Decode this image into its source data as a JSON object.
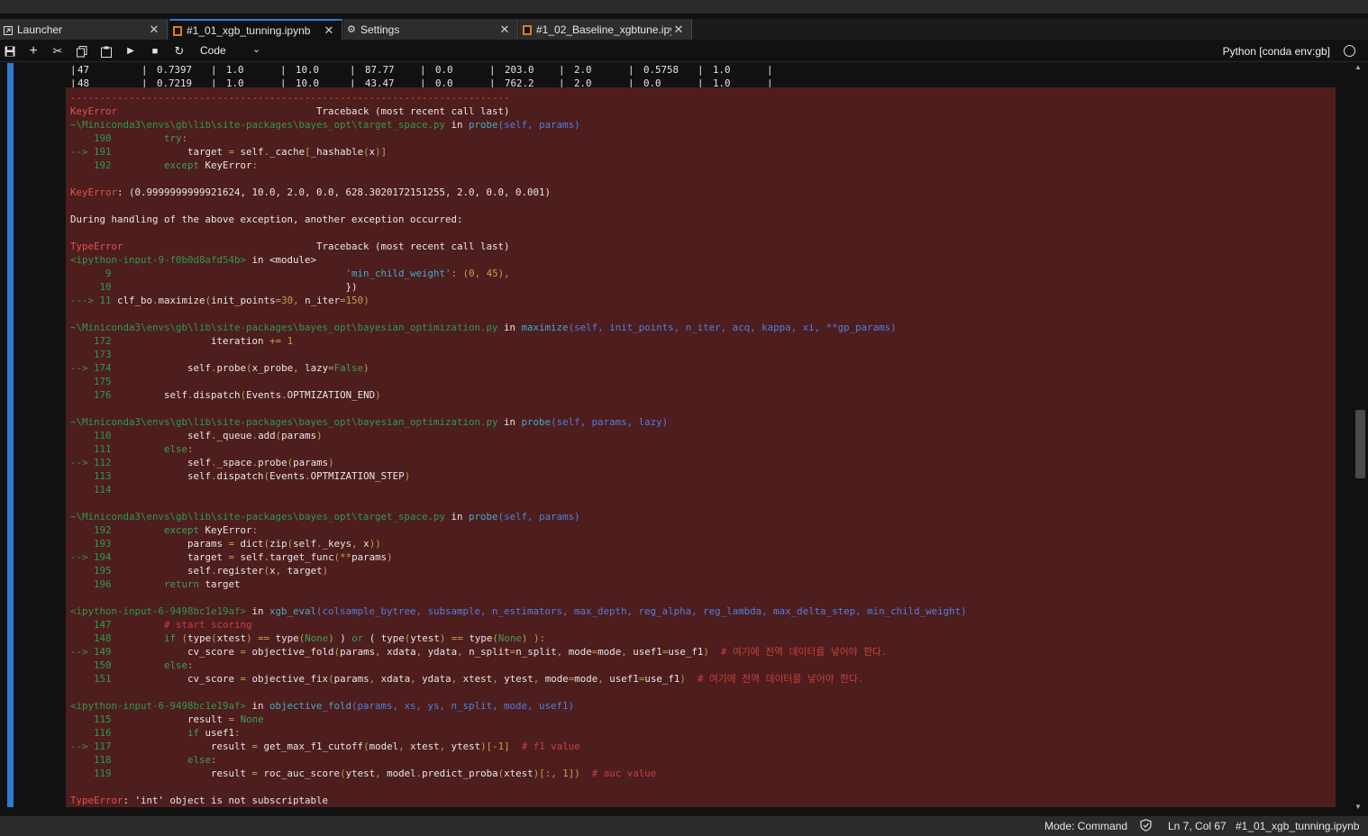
{
  "tabs": [
    {
      "label": "Launcher",
      "icon": "launcher-icon",
      "active": false
    },
    {
      "label": "#1_01_xgb_tunning.ipynb",
      "icon": "notebook-icon",
      "active": true
    },
    {
      "label": "Settings",
      "icon": "gear-icon",
      "active": false
    },
    {
      "label": "#1_02_Baseline_xgbtune.ipynb",
      "icon": "notebook-icon",
      "active": false
    }
  ],
  "toolbar": {
    "cell_type": "Code",
    "kernel": "Python [conda env:gb]",
    "buttons": [
      "save-icon",
      "plus-icon",
      "cut-icon",
      "copy-icon",
      "paste-icon",
      "run-icon",
      "stop-icon",
      "restart-icon"
    ]
  },
  "table_rows": [
    [
      "47",
      "0.7397",
      "1.0",
      "10.0",
      "87.77",
      "0.0",
      "203.0",
      "2.0",
      "0.5758",
      "1.0"
    ],
    [
      "48",
      "0.7219",
      "1.0",
      "10.0",
      "43.47",
      "0.0",
      "762.2",
      "2.0",
      "0.0",
      "1.0"
    ]
  ],
  "traceback": [
    [
      {
        "t": "---------------------------------------------------------------------------",
        "c": "r"
      }
    ],
    [
      {
        "t": "KeyError",
        "c": "r"
      },
      {
        "t": "                                  Traceback (most recent call last)"
      }
    ],
    [
      {
        "t": "~\\Miniconda3\\envs\\gb\\lib\\site-packages\\bayes_opt\\target_space.py",
        "c": "g"
      },
      {
        "t": " in "
      },
      {
        "t": "probe",
        "c": "c"
      },
      {
        "t": "(self, params)",
        "c": "b"
      }
    ],
    [
      {
        "t": "    190",
        "c": "g"
      },
      {
        "t": "         "
      },
      {
        "t": "try",
        "c": "k"
      },
      {
        "t": ":",
        "c": "y"
      }
    ],
    [
      {
        "t": "--> 191",
        "c": "g"
      },
      {
        "t": "             target "
      },
      {
        "t": "=",
        "c": "y"
      },
      {
        "t": " self"
      },
      {
        "t": ".",
        "c": "y"
      },
      {
        "t": "_cache"
      },
      {
        "t": "[",
        "c": "y"
      },
      {
        "t": "_hashable"
      },
      {
        "t": "(",
        "c": "y"
      },
      {
        "t": "x"
      },
      {
        "t": ")]",
        "c": "y"
      }
    ],
    [
      {
        "t": "    192",
        "c": "g"
      },
      {
        "t": "         "
      },
      {
        "t": "except",
        "c": "k"
      },
      {
        "t": " KeyError"
      },
      {
        "t": ":",
        "c": "y"
      }
    ],
    [
      {
        "t": ""
      }
    ],
    [
      {
        "t": "KeyError",
        "c": "r"
      },
      {
        "t": ": (0.9999999999921624, 10.0, 2.0, 0.0, 628.3020172151255, 2.0, 0.0, 0.001)"
      }
    ],
    [
      {
        "t": ""
      }
    ],
    [
      {
        "t": "During handling of the above exception, another exception occurred:"
      }
    ],
    [
      {
        "t": ""
      }
    ],
    [
      {
        "t": "TypeError",
        "c": "r"
      },
      {
        "t": "                                 Traceback (most recent call last)"
      }
    ],
    [
      {
        "t": "<ipython-input-9-f0b0d8afd54b>",
        "c": "g"
      },
      {
        "t": " in "
      },
      {
        "t": "<module>"
      }
    ],
    [
      {
        "t": "      9",
        "c": "g"
      },
      {
        "t": "                                        "
      },
      {
        "t": "'min_child_weight'",
        "c": "c"
      },
      {
        "t": ": ",
        "c": "y"
      },
      {
        "t": "(",
        "c": "y"
      },
      {
        "t": "0",
        "c": "y"
      },
      {
        "t": ", ",
        "c": "y"
      },
      {
        "t": "45",
        "c": "y"
      },
      {
        "t": "),",
        "c": "y"
      }
    ],
    [
      {
        "t": "     10",
        "c": "g"
      },
      {
        "t": "                                        })"
      }
    ],
    [
      {
        "t": "---> 11",
        "c": "g"
      },
      {
        "t": " clf_bo"
      },
      {
        "t": ".",
        "c": "y"
      },
      {
        "t": "maximize"
      },
      {
        "t": "(",
        "c": "y"
      },
      {
        "t": "init_points"
      },
      {
        "t": "=",
        "c": "y"
      },
      {
        "t": "30",
        "c": "y"
      },
      {
        "t": ", ",
        "c": "y"
      },
      {
        "t": "n_iter"
      },
      {
        "t": "=",
        "c": "y"
      },
      {
        "t": "150",
        "c": "y"
      },
      {
        "t": ")",
        "c": "y"
      }
    ],
    [
      {
        "t": ""
      }
    ],
    [
      {
        "t": "~\\Miniconda3\\envs\\gb\\lib\\site-packages\\bayes_opt\\bayesian_optimization.py",
        "c": "g"
      },
      {
        "t": " in "
      },
      {
        "t": "maximize",
        "c": "c"
      },
      {
        "t": "(self, init_points, n_iter, acq, kappa, xi, **gp_params)",
        "c": "b"
      }
    ],
    [
      {
        "t": "    172",
        "c": "g"
      },
      {
        "t": "                 iteration "
      },
      {
        "t": "+=",
        "c": "y"
      },
      {
        "t": " "
      },
      {
        "t": "1",
        "c": "y"
      }
    ],
    [
      {
        "t": "    173",
        "c": "g"
      }
    ],
    [
      {
        "t": "--> 174",
        "c": "g"
      },
      {
        "t": "             self"
      },
      {
        "t": ".",
        "c": "y"
      },
      {
        "t": "probe"
      },
      {
        "t": "(",
        "c": "y"
      },
      {
        "t": "x_probe"
      },
      {
        "t": ", ",
        "c": "y"
      },
      {
        "t": "lazy"
      },
      {
        "t": "=",
        "c": "y"
      },
      {
        "t": "False",
        "c": "k"
      },
      {
        "t": ")",
        "c": "y"
      }
    ],
    [
      {
        "t": "    175",
        "c": "g"
      }
    ],
    [
      {
        "t": "    176",
        "c": "g"
      },
      {
        "t": "         self"
      },
      {
        "t": ".",
        "c": "y"
      },
      {
        "t": "dispatch"
      },
      {
        "t": "(",
        "c": "y"
      },
      {
        "t": "Events"
      },
      {
        "t": ".",
        "c": "y"
      },
      {
        "t": "OPTMIZATION_END"
      },
      {
        "t": ")",
        "c": "y"
      }
    ],
    [
      {
        "t": ""
      }
    ],
    [
      {
        "t": "~\\Miniconda3\\envs\\gb\\lib\\site-packages\\bayes_opt\\bayesian_optimization.py",
        "c": "g"
      },
      {
        "t": " in "
      },
      {
        "t": "probe",
        "c": "c"
      },
      {
        "t": "(self, params, lazy)",
        "c": "b"
      }
    ],
    [
      {
        "t": "    110",
        "c": "g"
      },
      {
        "t": "             self"
      },
      {
        "t": ".",
        "c": "y"
      },
      {
        "t": "_queue"
      },
      {
        "t": ".",
        "c": "y"
      },
      {
        "t": "add"
      },
      {
        "t": "(",
        "c": "y"
      },
      {
        "t": "params"
      },
      {
        "t": ")",
        "c": "y"
      }
    ],
    [
      {
        "t": "    111",
        "c": "g"
      },
      {
        "t": "         "
      },
      {
        "t": "else",
        "c": "k"
      },
      {
        "t": ":",
        "c": "y"
      }
    ],
    [
      {
        "t": "--> 112",
        "c": "g"
      },
      {
        "t": "             self"
      },
      {
        "t": ".",
        "c": "y"
      },
      {
        "t": "_space"
      },
      {
        "t": ".",
        "c": "y"
      },
      {
        "t": "probe"
      },
      {
        "t": "(",
        "c": "y"
      },
      {
        "t": "params"
      },
      {
        "t": ")",
        "c": "y"
      }
    ],
    [
      {
        "t": "    113",
        "c": "g"
      },
      {
        "t": "             self"
      },
      {
        "t": ".",
        "c": "y"
      },
      {
        "t": "dispatch"
      },
      {
        "t": "(",
        "c": "y"
      },
      {
        "t": "Events"
      },
      {
        "t": ".",
        "c": "y"
      },
      {
        "t": "OPTMIZATION_STEP"
      },
      {
        "t": ")",
        "c": "y"
      }
    ],
    [
      {
        "t": "    114",
        "c": "g"
      }
    ],
    [
      {
        "t": ""
      }
    ],
    [
      {
        "t": "~\\Miniconda3\\envs\\gb\\lib\\site-packages\\bayes_opt\\target_space.py",
        "c": "g"
      },
      {
        "t": " in "
      },
      {
        "t": "probe",
        "c": "c"
      },
      {
        "t": "(self, params)",
        "c": "b"
      }
    ],
    [
      {
        "t": "    192",
        "c": "g"
      },
      {
        "t": "         "
      },
      {
        "t": "except",
        "c": "k"
      },
      {
        "t": " KeyError"
      },
      {
        "t": ":",
        "c": "y"
      }
    ],
    [
      {
        "t": "    193",
        "c": "g"
      },
      {
        "t": "             params "
      },
      {
        "t": "=",
        "c": "y"
      },
      {
        "t": " dict"
      },
      {
        "t": "(",
        "c": "y"
      },
      {
        "t": "zip"
      },
      {
        "t": "(",
        "c": "y"
      },
      {
        "t": "self"
      },
      {
        "t": ".",
        "c": "y"
      },
      {
        "t": "_keys"
      },
      {
        "t": ", ",
        "c": "y"
      },
      {
        "t": "x"
      },
      {
        "t": "))",
        "c": "y"
      }
    ],
    [
      {
        "t": "--> 194",
        "c": "g"
      },
      {
        "t": "             target "
      },
      {
        "t": "=",
        "c": "y"
      },
      {
        "t": " self"
      },
      {
        "t": ".",
        "c": "y"
      },
      {
        "t": "target_func"
      },
      {
        "t": "(**",
        "c": "y"
      },
      {
        "t": "params"
      },
      {
        "t": ")",
        "c": "y"
      }
    ],
    [
      {
        "t": "    195",
        "c": "g"
      },
      {
        "t": "             self"
      },
      {
        "t": ".",
        "c": "y"
      },
      {
        "t": "register"
      },
      {
        "t": "(",
        "c": "y"
      },
      {
        "t": "x"
      },
      {
        "t": ", ",
        "c": "y"
      },
      {
        "t": "target"
      },
      {
        "t": ")",
        "c": "y"
      }
    ],
    [
      {
        "t": "    196",
        "c": "g"
      },
      {
        "t": "         "
      },
      {
        "t": "return",
        "c": "k"
      },
      {
        "t": " target"
      }
    ],
    [
      {
        "t": ""
      }
    ],
    [
      {
        "t": "<ipython-input-6-9498bc1e19af>",
        "c": "g"
      },
      {
        "t": " in "
      },
      {
        "t": "xgb_eval",
        "c": "c"
      },
      {
        "t": "(colsample_bytree, subsample, n_estimators, max_depth, reg_alpha, reg_lambda, max_delta_step, min_child_weight)",
        "c": "b"
      }
    ],
    [
      {
        "t": "    147",
        "c": "g"
      },
      {
        "t": "         "
      },
      {
        "t": "# start scoring",
        "c": "cm"
      }
    ],
    [
      {
        "t": "    148",
        "c": "g"
      },
      {
        "t": "         "
      },
      {
        "t": "if",
        "c": "k"
      },
      {
        "t": " "
      },
      {
        "t": "(",
        "c": "y"
      },
      {
        "t": "type"
      },
      {
        "t": "(",
        "c": "y"
      },
      {
        "t": "xtest"
      },
      {
        "t": ")",
        "c": "y"
      },
      {
        "t": " "
      },
      {
        "t": "==",
        "c": "y"
      },
      {
        "t": " type"
      },
      {
        "t": "(",
        "c": "y"
      },
      {
        "t": "None",
        "c": "k"
      },
      {
        "t": ")",
        "c": "y"
      },
      {
        "t": " ) "
      },
      {
        "t": "or",
        "c": "k"
      },
      {
        "t": " ( "
      },
      {
        "t": "type"
      },
      {
        "t": "(",
        "c": "y"
      },
      {
        "t": "ytest"
      },
      {
        "t": ")",
        "c": "y"
      },
      {
        "t": " "
      },
      {
        "t": "==",
        "c": "y"
      },
      {
        "t": " type"
      },
      {
        "t": "(",
        "c": "y"
      },
      {
        "t": "None",
        "c": "k"
      },
      {
        "t": ")",
        "c": "y"
      },
      {
        "t": " ):",
        "c": "y"
      }
    ],
    [
      {
        "t": "--> 149",
        "c": "g"
      },
      {
        "t": "             cv_score "
      },
      {
        "t": "=",
        "c": "y"
      },
      {
        "t": " objective_fold"
      },
      {
        "t": "(",
        "c": "y"
      },
      {
        "t": "params"
      },
      {
        "t": ", ",
        "c": "y"
      },
      {
        "t": "xdata"
      },
      {
        "t": ", ",
        "c": "y"
      },
      {
        "t": "ydata"
      },
      {
        "t": ", ",
        "c": "y"
      },
      {
        "t": "n_split"
      },
      {
        "t": "=",
        "c": "y"
      },
      {
        "t": "n_split"
      },
      {
        "t": ", ",
        "c": "y"
      },
      {
        "t": "mode"
      },
      {
        "t": "=",
        "c": "y"
      },
      {
        "t": "mode"
      },
      {
        "t": ", ",
        "c": "y"
      },
      {
        "t": "usef1"
      },
      {
        "t": "=",
        "c": "y"
      },
      {
        "t": "use_f1"
      },
      {
        "t": ")",
        "c": "y"
      },
      {
        "t": "  "
      },
      {
        "t": "# 여기에 전역 데이터를 넣어야 한다.",
        "c": "cm"
      }
    ],
    [
      {
        "t": "    150",
        "c": "g"
      },
      {
        "t": "         "
      },
      {
        "t": "else",
        "c": "k"
      },
      {
        "t": ":",
        "c": "y"
      }
    ],
    [
      {
        "t": "    151",
        "c": "g"
      },
      {
        "t": "             cv_score "
      },
      {
        "t": "=",
        "c": "y"
      },
      {
        "t": " objective_fix"
      },
      {
        "t": "(",
        "c": "y"
      },
      {
        "t": "params"
      },
      {
        "t": ", ",
        "c": "y"
      },
      {
        "t": "xdata"
      },
      {
        "t": ", ",
        "c": "y"
      },
      {
        "t": "ydata"
      },
      {
        "t": ", ",
        "c": "y"
      },
      {
        "t": "xtest"
      },
      {
        "t": ", ",
        "c": "y"
      },
      {
        "t": "ytest"
      },
      {
        "t": ", ",
        "c": "y"
      },
      {
        "t": "mode"
      },
      {
        "t": "=",
        "c": "y"
      },
      {
        "t": "mode"
      },
      {
        "t": ", ",
        "c": "y"
      },
      {
        "t": "usef1"
      },
      {
        "t": "=",
        "c": "y"
      },
      {
        "t": "use_f1"
      },
      {
        "t": ")",
        "c": "y"
      },
      {
        "t": "  "
      },
      {
        "t": "# 여기에 전역 데이터를 넣어야 한다.",
        "c": "cm"
      }
    ],
    [
      {
        "t": ""
      }
    ],
    [
      {
        "t": "<ipython-input-6-9498bc1e19af>",
        "c": "g"
      },
      {
        "t": " in "
      },
      {
        "t": "objective_fold",
        "c": "c"
      },
      {
        "t": "(params, xs, ys, n_split, mode, usef1)",
        "c": "b"
      }
    ],
    [
      {
        "t": "    115",
        "c": "g"
      },
      {
        "t": "             result "
      },
      {
        "t": "=",
        "c": "y"
      },
      {
        "t": " "
      },
      {
        "t": "None",
        "c": "k"
      }
    ],
    [
      {
        "t": "    116",
        "c": "g"
      },
      {
        "t": "             "
      },
      {
        "t": "if",
        "c": "k"
      },
      {
        "t": " usef1"
      },
      {
        "t": ":",
        "c": "y"
      }
    ],
    [
      {
        "t": "--> 117",
        "c": "g"
      },
      {
        "t": "                 result "
      },
      {
        "t": "=",
        "c": "y"
      },
      {
        "t": " get_max_f1_cutoff"
      },
      {
        "t": "(",
        "c": "y"
      },
      {
        "t": "model"
      },
      {
        "t": ", ",
        "c": "y"
      },
      {
        "t": "xtest"
      },
      {
        "t": ", ",
        "c": "y"
      },
      {
        "t": "ytest"
      },
      {
        "t": ")[-1]",
        "c": "y"
      },
      {
        "t": "  "
      },
      {
        "t": "# f1 value",
        "c": "cm"
      }
    ],
    [
      {
        "t": "    118",
        "c": "g"
      },
      {
        "t": "             "
      },
      {
        "t": "else",
        "c": "k"
      },
      {
        "t": ":",
        "c": "y"
      }
    ],
    [
      {
        "t": "    119",
        "c": "g"
      },
      {
        "t": "                 result "
      },
      {
        "t": "=",
        "c": "y"
      },
      {
        "t": " roc_auc_score"
      },
      {
        "t": "(",
        "c": "y"
      },
      {
        "t": "ytest"
      },
      {
        "t": ", ",
        "c": "y"
      },
      {
        "t": "model"
      },
      {
        "t": ".",
        "c": "y"
      },
      {
        "t": "predict_proba"
      },
      {
        "t": "(",
        "c": "y"
      },
      {
        "t": "xtest"
      },
      {
        "t": ")[:, 1])",
        "c": "y"
      },
      {
        "t": "  "
      },
      {
        "t": "# auc value",
        "c": "cm"
      }
    ],
    [
      {
        "t": ""
      }
    ],
    [
      {
        "t": "TypeError",
        "c": "r"
      },
      {
        "t": ": 'int' object is not subscriptable"
      }
    ]
  ],
  "statusbar": {
    "mode": "Mode: Command",
    "position": "Ln 7, Col 67",
    "filename": "#1_01_xgb_tunning.ipynb"
  },
  "colors": {
    "accent": "#2f7bd3",
    "error_bg": "#4e1d1d",
    "error_red": "#e2514c",
    "path_green": "#2e9a4f"
  }
}
